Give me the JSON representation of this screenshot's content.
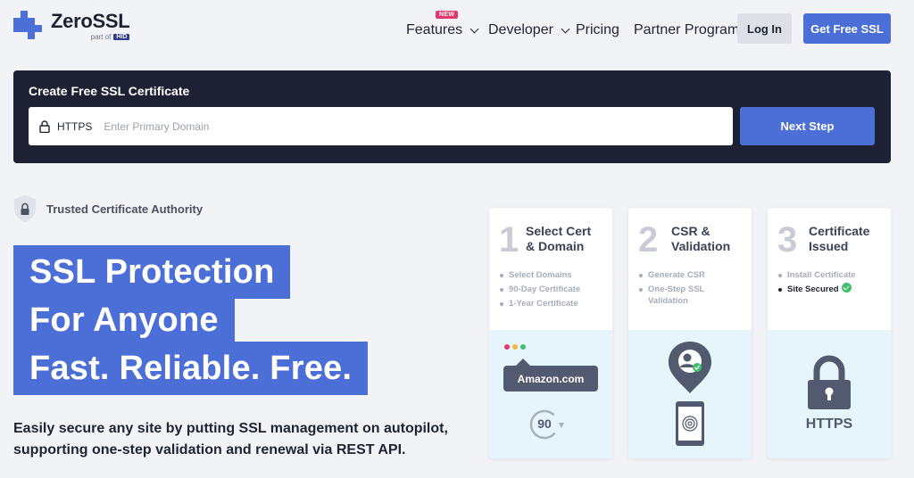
{
  "header": {
    "logo_name": "ZeroSSL",
    "logo_partof": "part of",
    "logo_hid": "HID",
    "nav": {
      "features": "Features",
      "features_badge": "NEW",
      "developer": "Developer",
      "pricing": "Pricing",
      "partner": "Partner Program"
    },
    "login": "Log In",
    "get_free": "Get Free SSL"
  },
  "create_panel": {
    "title": "Create Free SSL Certificate",
    "protocol": "HTTPS",
    "domain_placeholder": "Enter Primary Domain",
    "domain_value": "",
    "next_button": "Next Step"
  },
  "hero": {
    "trusted": "Trusted Certificate Authority",
    "line1": "SSL Protection",
    "line2": "For Anyone",
    "line3": "Fast. Reliable. Free.",
    "description": "Easily secure any site by putting SSL management on autopilot, supporting one-step validation and renewal via REST API."
  },
  "steps": [
    {
      "number": "1",
      "title_line1": "Select Cert",
      "title_line2": "& Domain",
      "items": [
        "Select Domains",
        "90-Day Certificate",
        "1-Year Certificate"
      ],
      "illustration": {
        "domain": "Amazon.com",
        "days": "90"
      }
    },
    {
      "number": "2",
      "title_line1": "CSR &",
      "title_line2": "Validation",
      "items": [
        "Generate CSR",
        "One-Step SSL",
        "Validation"
      ]
    },
    {
      "number": "3",
      "title_line1": "Certificate",
      "title_line2": "Issued",
      "items": [
        "Install Certificate",
        "Site Secured"
      ],
      "illustration": {
        "label": "HTTPS"
      }
    }
  ],
  "colors": {
    "brand": "#4b6fd6",
    "dark_panel": "#1d2133",
    "new_badge": "#e2386b",
    "success": "#3ec06c",
    "card_tint": "#e6f5fb"
  }
}
